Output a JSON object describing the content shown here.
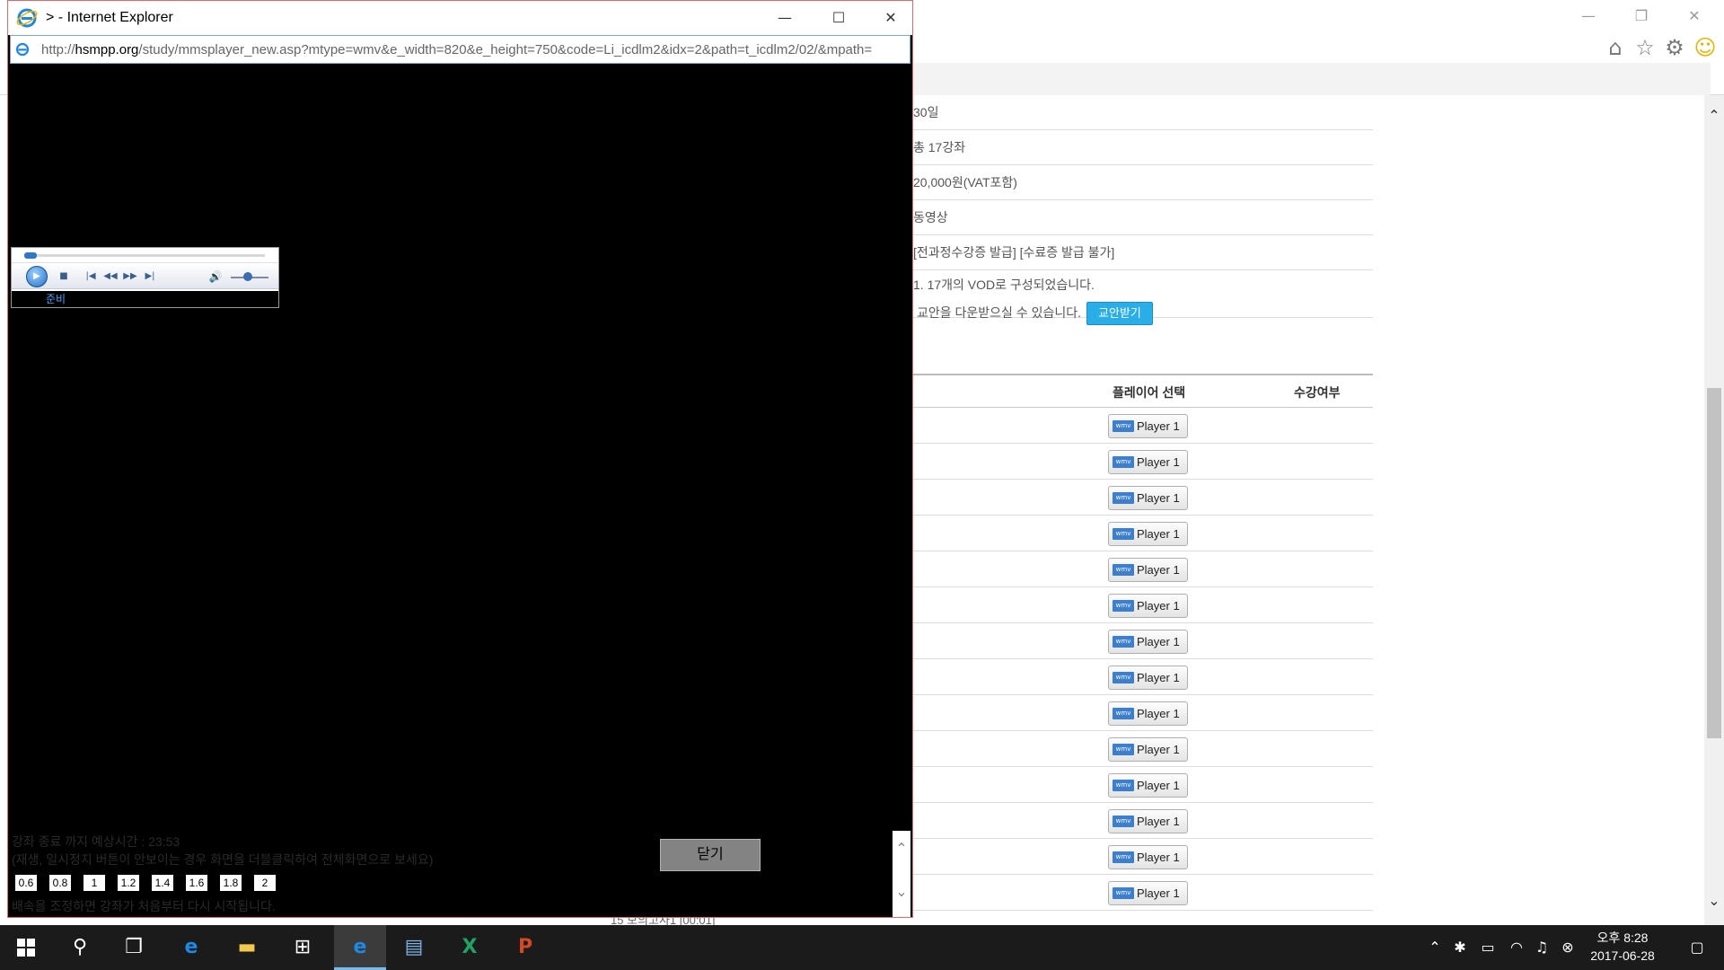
{
  "background_window": {
    "controls": {
      "minimize": "—",
      "restore": "❐",
      "close": "✕"
    },
    "toolbar_icons": [
      "home-icon",
      "favorites-star-icon",
      "settings-gear-icon",
      "feedback-smiley-icon"
    ],
    "info_rows": [
      {
        "text": "30일"
      },
      {
        "text": "총 17강좌"
      },
      {
        "text": "20,000원(VAT포함)"
      },
      {
        "text": "동영상"
      },
      {
        "text": "[전과정수강증 발급] [수료증 발급 불가]"
      }
    ],
    "description": {
      "line1": "1. 17개의 VOD로 구성되었습니다.",
      "line2": "교안을 다운받으실 수 있습니다.",
      "download_button": "교안받기"
    },
    "table": {
      "headers": {
        "player": "플레이어 선택",
        "status": "수강여부"
      },
      "rows": [
        {
          "player_label": "Player 1",
          "badge": "wmv"
        },
        {
          "player_label": "Player 1",
          "badge": "wmv"
        },
        {
          "player_label": "Player 1",
          "badge": "wmv"
        },
        {
          "player_label": "Player 1",
          "badge": "wmv"
        },
        {
          "player_label": "Player 1",
          "badge": "wmv"
        },
        {
          "player_label": "Player 1",
          "badge": "wmv"
        },
        {
          "player_label": "Player 1",
          "badge": "wmv"
        },
        {
          "player_label": "Player 1",
          "badge": "wmv"
        },
        {
          "player_label": "Player 1",
          "badge": "wmv"
        },
        {
          "player_label": "Player 1",
          "badge": "wmv"
        },
        {
          "player_label": "Player 1",
          "badge": "wmv"
        },
        {
          "player_label": "Player 1",
          "badge": "wmv"
        },
        {
          "player_label": "Player 1",
          "badge": "wmv"
        },
        {
          "player_label": "Player 1",
          "badge": "wmv"
        }
      ]
    },
    "bottom_peek": "15         모의고사1  [00:01]"
  },
  "popup": {
    "title": "> - Internet Explorer",
    "controls": {
      "minimize": "—",
      "maximize": "☐",
      "close": "✕"
    },
    "address": {
      "prefix": "http://",
      "domain": "hsmpp.org",
      "path": "/study/mmsplayer_new.asp?mtype=wmv&e_width=820&e_height=750&code=Li_icdlm2&idx=2&path=t_icdlm2/02/&mpath="
    },
    "media_player": {
      "status": "준비",
      "seek_progress": 0.0,
      "volume_level": 0.45
    },
    "info": {
      "line1": "강좌 종료 까지 예상시간 : 23:53",
      "line2": "(재생, 일시정지 버튼이 안보이는 경우 화면을 더블클릭하여 전체화면으로 보세요)",
      "line3": "배속을 조정하면 강좌가 처음부터 다시 시작됩니다."
    },
    "speed_options": [
      "0.6",
      "0.8",
      "1",
      "1.2",
      "1.4",
      "1.6",
      "1.8",
      "2"
    ],
    "close_button": "닫기"
  },
  "taskbar": {
    "apps": [
      "windows-start-icon",
      "search-icon",
      "task-view-icon",
      "edge-icon",
      "file-explorer-icon",
      "store-icon",
      "internet-explorer-icon",
      "reader-app-icon",
      "excel-icon",
      "powerpoint-icon"
    ],
    "clock": {
      "time": "오후 8:28",
      "date": "2017-06-28"
    }
  }
}
